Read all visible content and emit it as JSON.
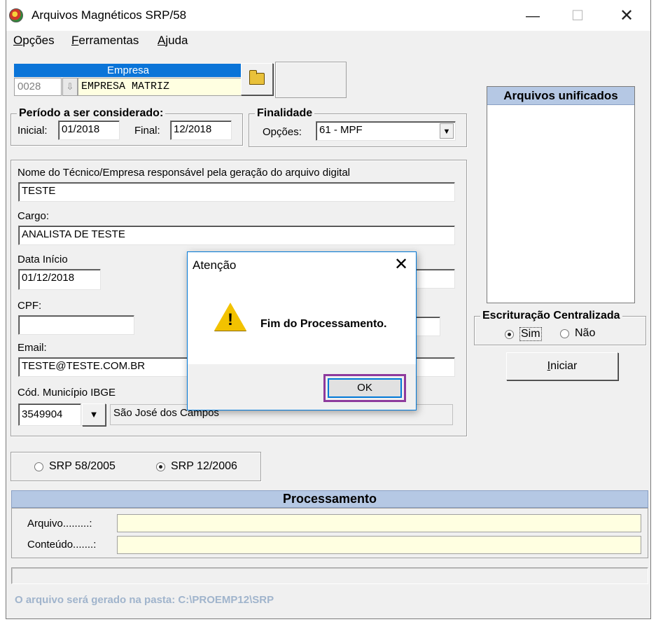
{
  "window": {
    "title": "Arquivos Magnéticos SRP/58",
    "minimize": "—",
    "maximize": "☐",
    "close": "✕"
  },
  "menu": [
    {
      "hotkey": "O",
      "rest": "pções"
    },
    {
      "hotkey": "F",
      "rest": "erramentas"
    },
    {
      "hotkey": "A",
      "rest": "juda"
    }
  ],
  "empresa": {
    "header": "Empresa",
    "code": "0028",
    "spin": "⇩",
    "name": "EMPRESA MATRIZ"
  },
  "periodo": {
    "title": "Período a ser considerado:",
    "inicial_label": "Inicial:",
    "inicial": "01/2018",
    "final_label": "Final:",
    "final": "12/2018"
  },
  "finalidade": {
    "title": "Finalidade",
    "opcoes_label": "Opções:",
    "opcao": "61 - MPF",
    "arrow": "▼"
  },
  "responsavel": {
    "nome_label": "Nome do Técnico/Empresa responsável pela geração do arquivo digital",
    "nome": "TESTE",
    "cargo_label": "Cargo:",
    "cargo": "ANALISTA DE TESTE",
    "data_inicio_label": "Data Início",
    "data_inicio": "01/12/2018",
    "cpf_label": "CPF:",
    "cpf": "",
    "email_label": "Email:",
    "email": "TESTE@TESTE.COM.BR",
    "municipio_label": "Cód. Município IBGE",
    "municipio_codigo": "3549904",
    "municipio_arrow": "▼",
    "municipio_nome": "São José dos Campos"
  },
  "arquivos_unificados": {
    "header": "Arquivos unificados"
  },
  "escrituracao": {
    "title": "Escrituração Centralizada",
    "sim": "Sim",
    "nao": "Não",
    "selected": "Sim"
  },
  "iniciar": {
    "hotkey": "I",
    "rest": "niciar"
  },
  "srp": {
    "opt1": "SRP 58/2005",
    "opt2": "SRP 12/2006",
    "selected": "SRP 12/2006"
  },
  "processamento": {
    "header": "Processamento",
    "arquivo_label": "Arquivo.........:",
    "arquivo": "",
    "conteudo_label": "Conteúdo.......:",
    "conteudo": ""
  },
  "folder_note": "O arquivo será gerado na pasta: C:\\PROEMP12\\SRP",
  "dialog": {
    "title": "Atenção",
    "close": "✕",
    "warn_mark": "!",
    "message": "Fim do Processamento.",
    "ok": "OK"
  }
}
